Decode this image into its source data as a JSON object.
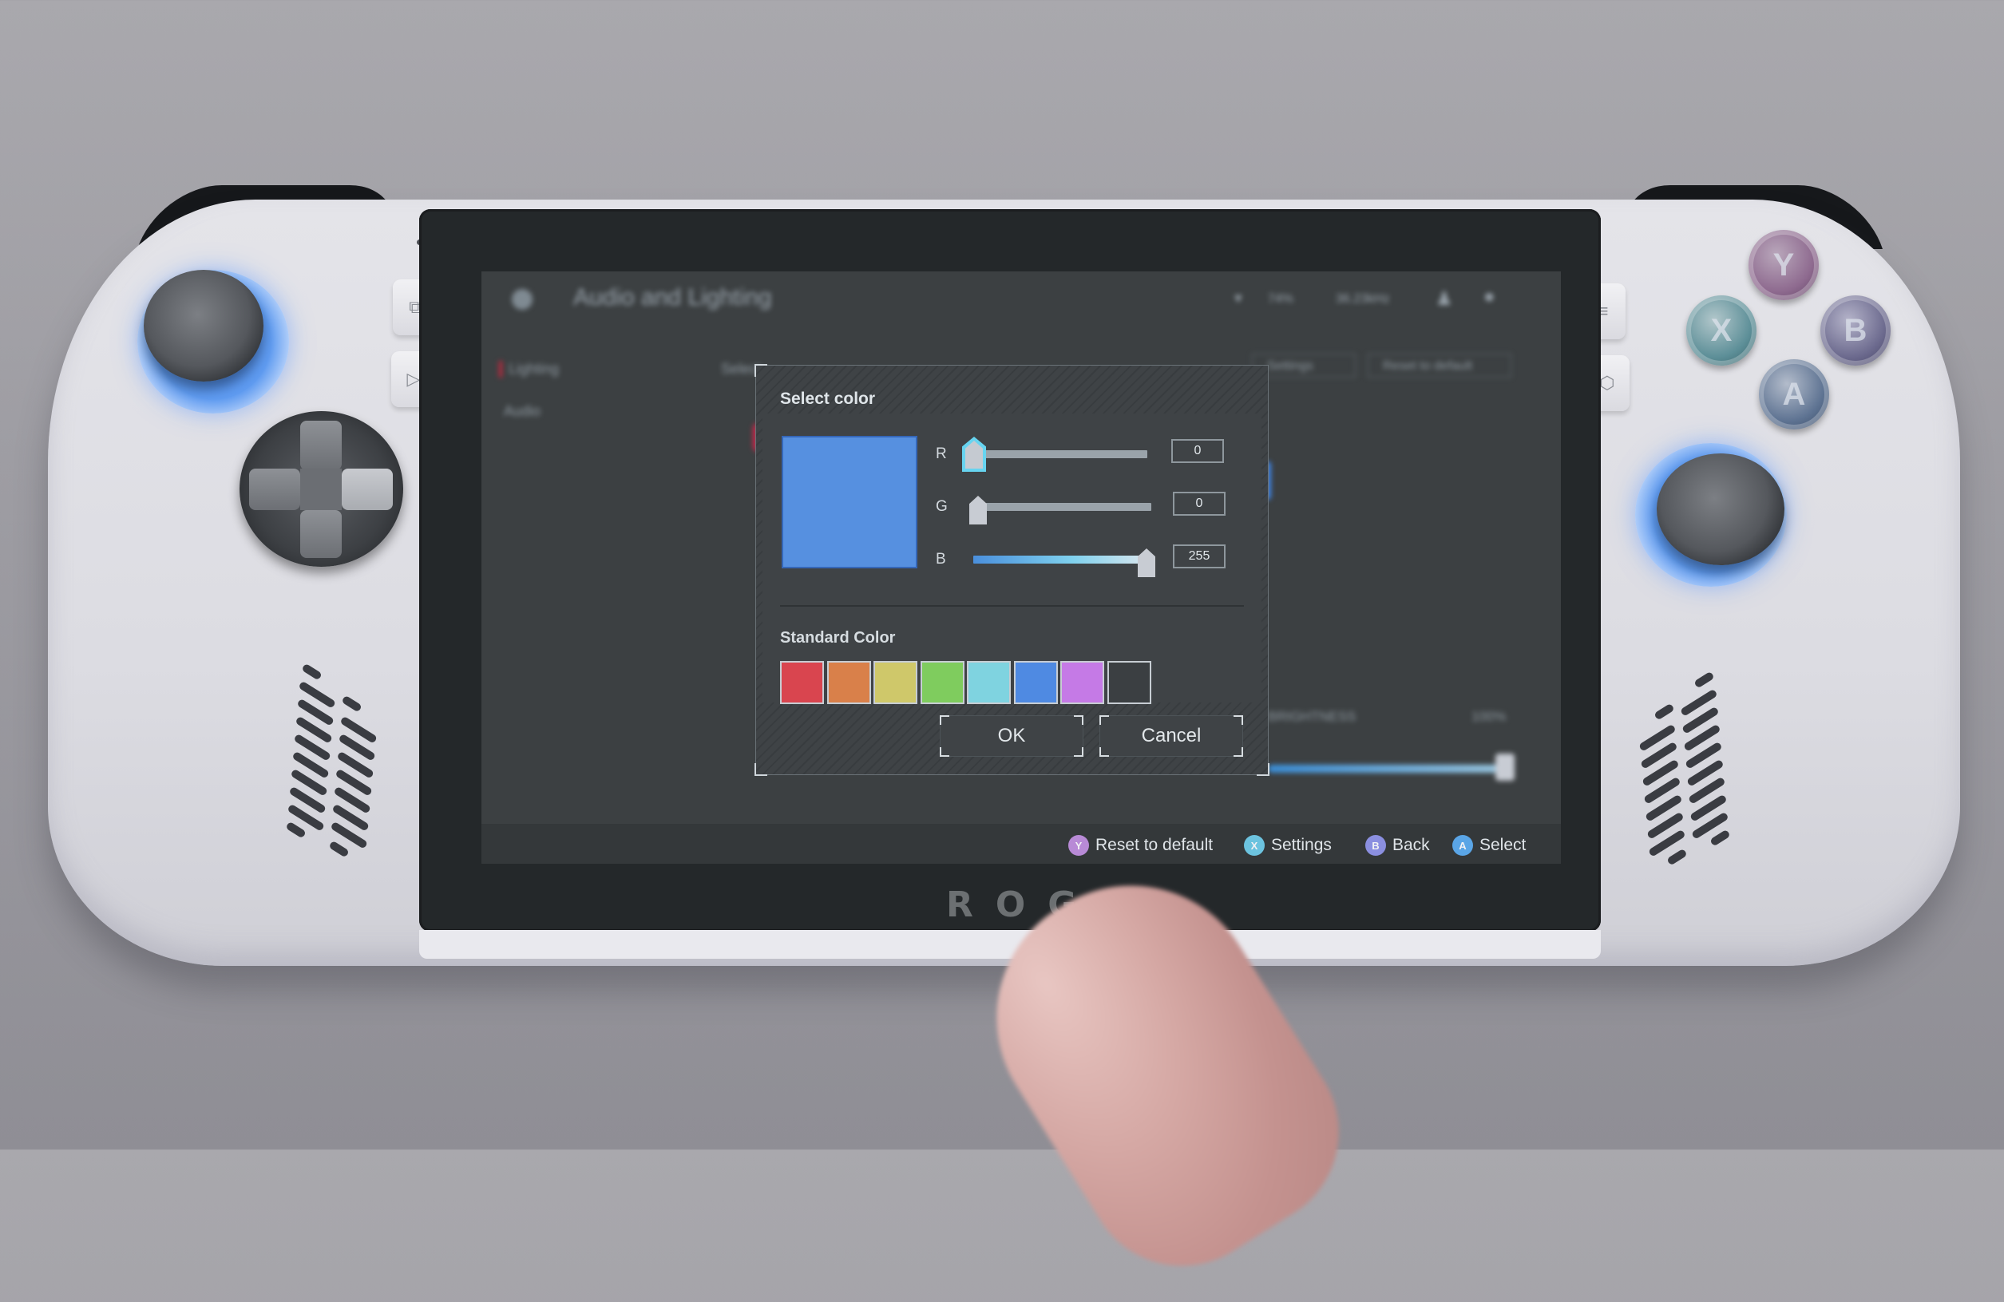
{
  "device": {
    "brand_logo": "ROG",
    "side_buttons_left": [
      {
        "icon": "view-icon",
        "glyph": "⧉"
      },
      {
        "icon": "armoury-play-icon",
        "glyph": "▷"
      }
    ],
    "side_buttons_right": [
      {
        "icon": "menu-icon",
        "glyph": "≡"
      },
      {
        "icon": "command-center-icon",
        "glyph": "⬡"
      }
    ],
    "face_buttons": [
      {
        "label": "Y",
        "color": "#8e6a8f"
      },
      {
        "label": "X",
        "color": "#5d8f98"
      },
      {
        "label": "B",
        "color": "#6c6a8e"
      },
      {
        "label": "A",
        "color": "#5e7392"
      }
    ],
    "stick_light_color": "#4a8cf0"
  },
  "background_app": {
    "title": "Audio and Lighting",
    "sidebar": [
      {
        "label": "Lighting",
        "active": true
      },
      {
        "label": "Audio",
        "active": false
      }
    ],
    "status": {
      "battery": "74%",
      "network": "36.23kHz"
    },
    "top_buttons": [
      {
        "label": "Settings"
      },
      {
        "label": "Reset to default"
      }
    ],
    "section_label": "Select",
    "brightness": {
      "label": "BRIGHTNESS",
      "value": "100%",
      "fraction": 1.0
    }
  },
  "dialog": {
    "title": "Select color",
    "preview_color": "#5690e0",
    "channels": [
      {
        "label": "R",
        "value": "0",
        "fraction": 0.0,
        "focused": true
      },
      {
        "label": "G",
        "value": "0",
        "fraction": 0.0,
        "focused": false
      },
      {
        "label": "B",
        "value": "255",
        "fraction": 1.0,
        "focused": false
      }
    ],
    "standard_color_title": "Standard Color",
    "standard_colors": [
      "#d9454f",
      "#d9804a",
      "#cfc86a",
      "#7fcc5e",
      "#7fd3e0",
      "#4f8ae2",
      "#c57ae6",
      "#3b3f42"
    ],
    "ok_label": "OK",
    "cancel_label": "Cancel"
  },
  "footer": {
    "hints": [
      {
        "glyph": "Y",
        "label": "Reset to default",
        "color": "#b88ad6"
      },
      {
        "glyph": "X",
        "label": "Settings",
        "color": "#6cc3df"
      },
      {
        "glyph": "B",
        "label": "Back",
        "color": "#8b8fe0"
      },
      {
        "glyph": "A",
        "label": "Select",
        "color": "#5aa5e6"
      }
    ]
  }
}
